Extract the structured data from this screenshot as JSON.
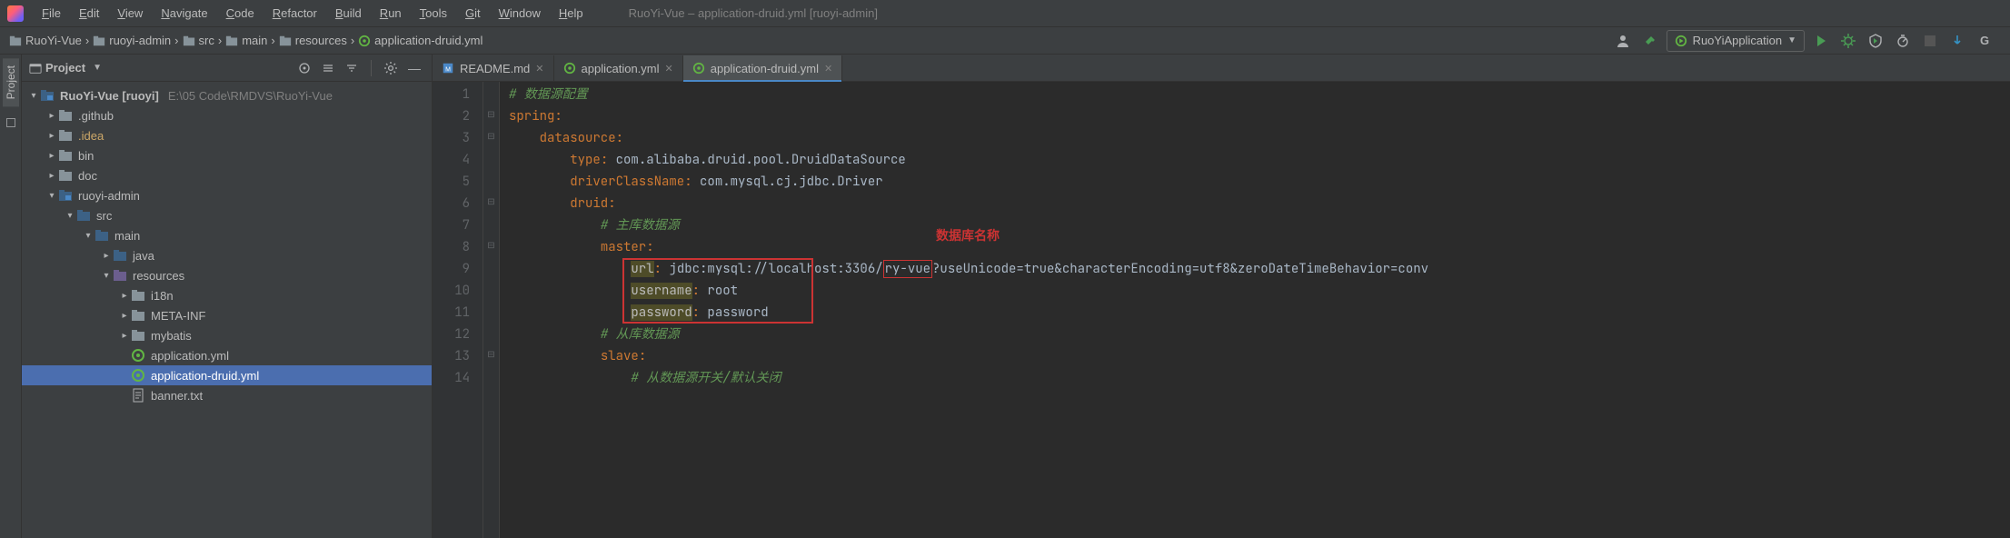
{
  "window_title": "RuoYi-Vue – application-druid.yml [ruoyi-admin]",
  "menubar": [
    "File",
    "Edit",
    "View",
    "Navigate",
    "Code",
    "Refactor",
    "Build",
    "Run",
    "Tools",
    "Git",
    "Window",
    "Help"
  ],
  "breadcrumbs": [
    "RuoYi-Vue",
    "ruoyi-admin",
    "src",
    "main",
    "resources",
    "application-druid.yml"
  ],
  "run_config": "RuoYiApplication",
  "project": {
    "title": "Project",
    "root": {
      "label": "RuoYi-Vue [ruoyi]",
      "aux": "E:\\05 Code\\RMDVS\\RuoYi-Vue"
    },
    "items": [
      {
        "indent": 1,
        "expand": ">",
        "type": "folder",
        "label": ".github"
      },
      {
        "indent": 1,
        "expand": ">",
        "type": "folder-hl",
        "label": ".idea"
      },
      {
        "indent": 1,
        "expand": ">",
        "type": "folder",
        "label": "bin"
      },
      {
        "indent": 1,
        "expand": ">",
        "type": "folder",
        "label": "doc"
      },
      {
        "indent": 1,
        "expand": "v",
        "type": "module",
        "label": "ruoyi-admin"
      },
      {
        "indent": 2,
        "expand": "v",
        "type": "src",
        "label": "src"
      },
      {
        "indent": 3,
        "expand": "v",
        "type": "src",
        "label": "main"
      },
      {
        "indent": 4,
        "expand": ">",
        "type": "src",
        "label": "java"
      },
      {
        "indent": 4,
        "expand": "v",
        "type": "res",
        "label": "resources"
      },
      {
        "indent": 5,
        "expand": ">",
        "type": "folder",
        "label": "i18n"
      },
      {
        "indent": 5,
        "expand": ">",
        "type": "folder",
        "label": "META-INF"
      },
      {
        "indent": 5,
        "expand": ">",
        "type": "folder",
        "label": "mybatis"
      },
      {
        "indent": 5,
        "expand": "",
        "type": "cfg",
        "label": "application.yml"
      },
      {
        "indent": 5,
        "expand": "",
        "type": "cfg",
        "label": "application-druid.yml",
        "selected": true
      },
      {
        "indent": 5,
        "expand": "",
        "type": "txt",
        "label": "banner.txt"
      }
    ]
  },
  "editor_tabs": [
    {
      "label": "README.md",
      "icon": "md"
    },
    {
      "label": "application.yml",
      "icon": "cfg"
    },
    {
      "label": "application-druid.yml",
      "icon": "cfg",
      "active": true
    }
  ],
  "code": {
    "annotation_db": "数据库名称",
    "lines": [
      {
        "n": 1,
        "t": "comment",
        "text": "# 数据源配置"
      },
      {
        "n": 2,
        "t": "kv",
        "key": "spring",
        "val": ""
      },
      {
        "n": 3,
        "t": "kv",
        "key": "datasource",
        "val": "",
        "ind": 4
      },
      {
        "n": 4,
        "t": "kv",
        "key": "type",
        "val": "com.alibaba.druid.pool.DruidDataSource",
        "ind": 8
      },
      {
        "n": 5,
        "t": "kv",
        "key": "driverClassName",
        "val": "com.mysql.cj.jdbc.Driver",
        "ind": 8
      },
      {
        "n": 6,
        "t": "kv",
        "key": "druid",
        "val": "",
        "ind": 8
      },
      {
        "n": 7,
        "t": "comment",
        "text": "# 主库数据源",
        "ind": 12
      },
      {
        "n": 8,
        "t": "kv",
        "key": "master",
        "val": "",
        "ind": 12
      },
      {
        "n": 9,
        "t": "url",
        "key": "url",
        "url_pre": "jdbc:mysql://localhost:3306/",
        "db": "ry-vue",
        "url_post": "?useUnicode=true&characterEncoding=utf8&zeroDateTimeBehavior=conv",
        "ind": 16
      },
      {
        "n": 10,
        "t": "warn",
        "key": "username",
        "val": "root",
        "ind": 16
      },
      {
        "n": 11,
        "t": "warn",
        "key": "password",
        "val": "password",
        "ind": 16
      },
      {
        "n": 12,
        "t": "comment",
        "text": "# 从库数据源",
        "ind": 12
      },
      {
        "n": 13,
        "t": "kv",
        "key": "slave",
        "val": "",
        "ind": 12
      },
      {
        "n": 14,
        "t": "comment",
        "text": "# 从数据源开关/默认关闭",
        "ind": 16
      }
    ]
  }
}
